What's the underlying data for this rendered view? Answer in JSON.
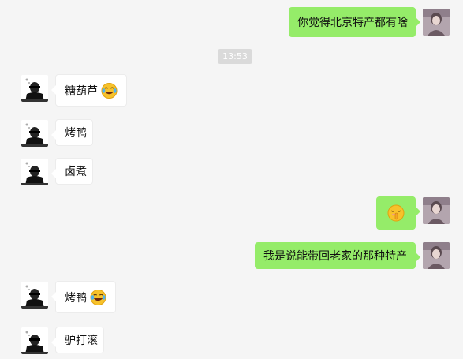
{
  "conversation": {
    "timestamp": "13:53",
    "messages": [
      {
        "side": "right",
        "text": "你觉得北京特产都有啥"
      },
      {
        "side": "left",
        "text": "糖葫芦",
        "emoji": "laughing-crying-emoji"
      },
      {
        "side": "left",
        "text": "烤鸭"
      },
      {
        "side": "left",
        "text": "卤煮"
      },
      {
        "side": "right",
        "text": "",
        "emoji": "shush-emoji"
      },
      {
        "side": "right",
        "text": "我是说能带回老家的那种特产"
      },
      {
        "side": "left",
        "text": "烤鸭",
        "emoji": "laughing-crying-emoji"
      },
      {
        "side": "left",
        "text": "驴打滚"
      }
    ]
  },
  "colors": {
    "background": "#f5f5f5",
    "self_bubble": "#95ec69",
    "other_bubble": "#ffffff",
    "timestamp_bg": "#dadada"
  }
}
